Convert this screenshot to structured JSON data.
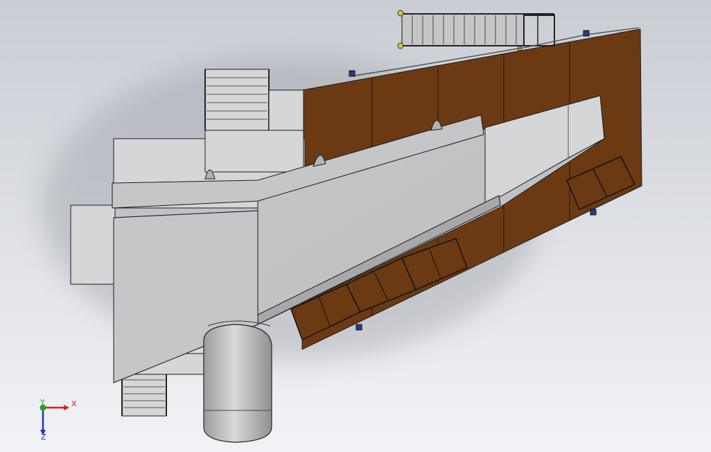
{
  "view": {
    "background_top": "#c9cdd4",
    "background_bottom": "#f2f3f6",
    "floor_color": "#6b3a12",
    "steel_color": "#c4c6c8",
    "steel_light": "#d4d6d8",
    "steel_dark": "#a6a8aa",
    "edge_color": "#1a1a1a"
  },
  "triad": {
    "x_label": "X",
    "y_label": "Y",
    "z_label": "Z",
    "x_color": "#d42020",
    "y_color": "#1fa51f",
    "z_color": "#2030c8"
  }
}
